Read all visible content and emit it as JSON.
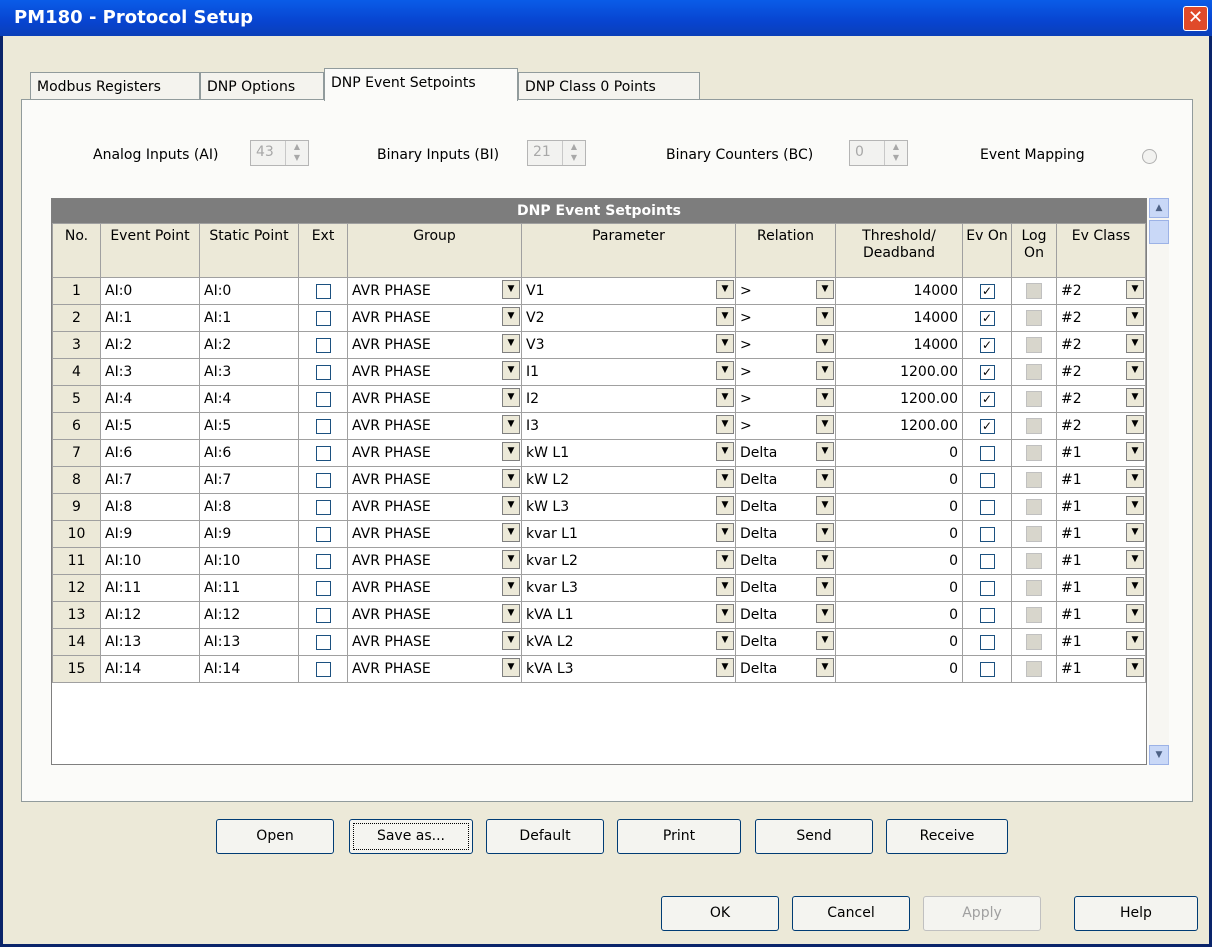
{
  "window": {
    "title": "PM180 - Protocol Setup",
    "close_glyph": "✕"
  },
  "tabs": [
    {
      "label": "Modbus Registers"
    },
    {
      "label": "DNP Options"
    },
    {
      "label": "DNP Event Setpoints"
    },
    {
      "label": "DNP Class 0 Points"
    }
  ],
  "top": {
    "ai_label": "Analog Inputs (AI)",
    "ai_value": "43",
    "bi_label": "Binary Inputs (BI)",
    "bi_value": "21",
    "bc_label": "Binary Counters (BC)",
    "bc_value": "0",
    "em_label": "Event Mapping"
  },
  "grid": {
    "title": "DNP Event Setpoints",
    "headers": [
      "No.",
      "Event Point",
      "Static Point",
      "Ext",
      "Group",
      "Parameter",
      "Relation",
      "Threshold/ Deadband",
      "Ev On",
      "Log On",
      "Ev Class"
    ],
    "rows": [
      {
        "no": "1",
        "event": "AI:0",
        "static": "AI:0",
        "group": "AVR PHASE",
        "param": "V1",
        "rel": ">",
        "thr": "14000",
        "ev_on": true,
        "cls": "#2"
      },
      {
        "no": "2",
        "event": "AI:1",
        "static": "AI:1",
        "group": "AVR PHASE",
        "param": "V2",
        "rel": ">",
        "thr": "14000",
        "ev_on": true,
        "cls": "#2"
      },
      {
        "no": "3",
        "event": "AI:2",
        "static": "AI:2",
        "group": "AVR PHASE",
        "param": "V3",
        "rel": ">",
        "thr": "14000",
        "ev_on": true,
        "cls": "#2"
      },
      {
        "no": "4",
        "event": "AI:3",
        "static": "AI:3",
        "group": "AVR PHASE",
        "param": "I1",
        "rel": ">",
        "thr": "1200.00",
        "ev_on": true,
        "cls": "#2"
      },
      {
        "no": "5",
        "event": "AI:4",
        "static": "AI:4",
        "group": "AVR PHASE",
        "param": "I2",
        "rel": ">",
        "thr": "1200.00",
        "ev_on": true,
        "cls": "#2"
      },
      {
        "no": "6",
        "event": "AI:5",
        "static": "AI:5",
        "group": "AVR PHASE",
        "param": "I3",
        "rel": ">",
        "thr": "1200.00",
        "ev_on": true,
        "cls": "#2"
      },
      {
        "no": "7",
        "event": "AI:6",
        "static": "AI:6",
        "group": "AVR PHASE",
        "param": "kW L1",
        "rel": "Delta",
        "thr": "0",
        "ev_on": false,
        "cls": "#1"
      },
      {
        "no": "8",
        "event": "AI:7",
        "static": "AI:7",
        "group": "AVR PHASE",
        "param": "kW L2",
        "rel": "Delta",
        "thr": "0",
        "ev_on": false,
        "cls": "#1"
      },
      {
        "no": "9",
        "event": "AI:8",
        "static": "AI:8",
        "group": "AVR PHASE",
        "param": "kW L3",
        "rel": "Delta",
        "thr": "0",
        "ev_on": false,
        "cls": "#1"
      },
      {
        "no": "10",
        "event": "AI:9",
        "static": "AI:9",
        "group": "AVR PHASE",
        "param": "kvar L1",
        "rel": "Delta",
        "thr": "0",
        "ev_on": false,
        "cls": "#1"
      },
      {
        "no": "11",
        "event": "AI:10",
        "static": "AI:10",
        "group": "AVR PHASE",
        "param": "kvar L2",
        "rel": "Delta",
        "thr": "0",
        "ev_on": false,
        "cls": "#1"
      },
      {
        "no": "12",
        "event": "AI:11",
        "static": "AI:11",
        "group": "AVR PHASE",
        "param": "kvar L3",
        "rel": "Delta",
        "thr": "0",
        "ev_on": false,
        "cls": "#1"
      },
      {
        "no": "13",
        "event": "AI:12",
        "static": "AI:12",
        "group": "AVR PHASE",
        "param": "kVA L1",
        "rel": "Delta",
        "thr": "0",
        "ev_on": false,
        "cls": "#1"
      },
      {
        "no": "14",
        "event": "AI:13",
        "static": "AI:13",
        "group": "AVR PHASE",
        "param": "kVA L2",
        "rel": "Delta",
        "thr": "0",
        "ev_on": false,
        "cls": "#1"
      },
      {
        "no": "15",
        "event": "AI:14",
        "static": "AI:14",
        "group": "AVR PHASE",
        "param": "kVA L3",
        "rel": "Delta",
        "thr": "0",
        "ev_on": false,
        "cls": "#1"
      }
    ]
  },
  "buttons": {
    "open": "Open",
    "save_as": "Save as...",
    "default": "Default",
    "print": "Print",
    "send": "Send",
    "receive": "Receive"
  },
  "dialog_buttons": {
    "ok": "OK",
    "cancel": "Cancel",
    "apply": "Apply",
    "help": "Help"
  },
  "glyphs": {
    "dropdown": "▼",
    "check": "✓",
    "scroll_up": "▲",
    "scroll_down": "▼",
    "spin": "▲\n▼"
  }
}
